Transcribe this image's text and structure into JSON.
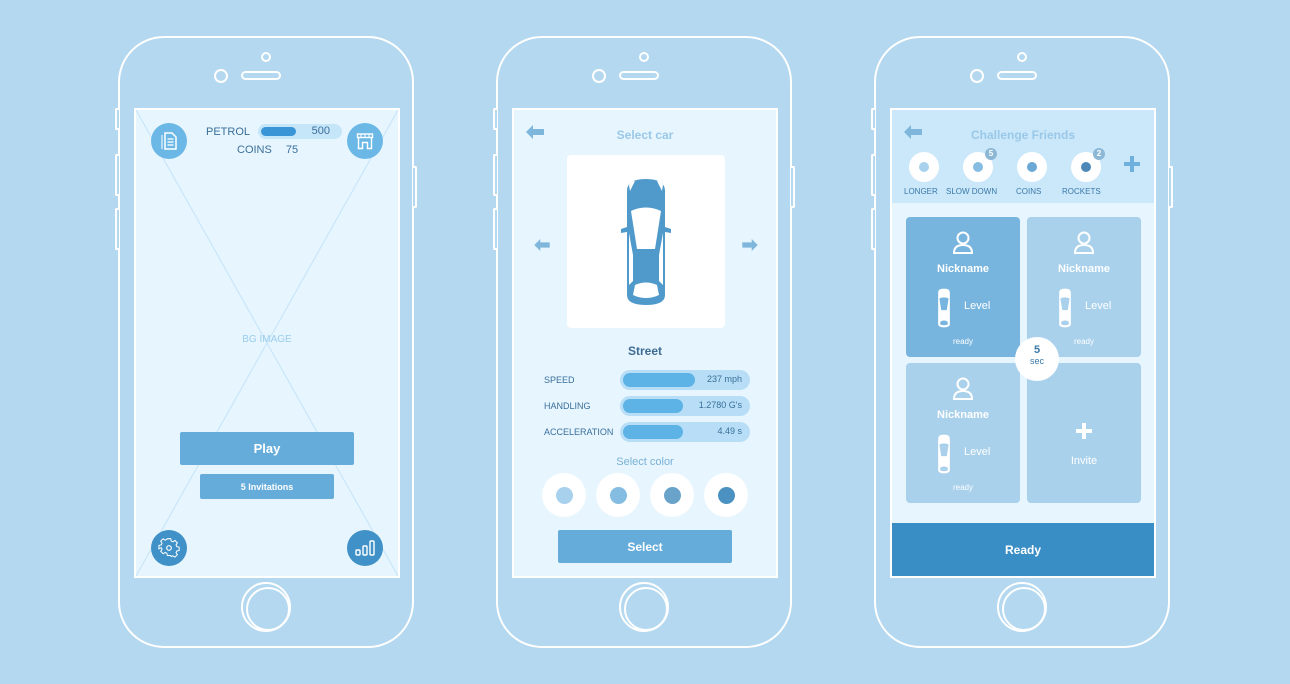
{
  "phone1": {
    "petrol_label": "PETROL",
    "petrol_value": "500",
    "petrol_level": 0.45,
    "coins_label": "COINS",
    "coins_value": "75",
    "bg_label": "BG IMAGE",
    "play_label": "Play",
    "invitations_label": "5 Invitations",
    "icons": {
      "top_left": "document-icon",
      "top_right": "shop-icon",
      "bottom_left": "gear-icon",
      "bottom_right": "stats-icon"
    }
  },
  "phone2": {
    "title": "Select car",
    "car_name": "Street",
    "stats": [
      {
        "label": "SPEED",
        "value": "237 mph",
        "level": 0.58
      },
      {
        "label": "HANDLING",
        "value": "1.2780 G's",
        "level": 0.48
      },
      {
        "label": "ACCELERATION",
        "value": "4.49 s",
        "level": 0.48
      }
    ],
    "select_color_label": "Select color",
    "colors": [
      "#a8d1ee",
      "#85bce2",
      "#6aa3c9",
      "#4b92c2"
    ],
    "select_label": "Select"
  },
  "phone3": {
    "title": "Challenge Friends",
    "powerups": [
      {
        "label": "LONGER",
        "color": "#a8d1ee",
        "badge": ""
      },
      {
        "label": "SLOW DOWN",
        "color": "#85bce2",
        "badge": "5"
      },
      {
        "label": "COINS",
        "color": "#6aa8d6",
        "badge": ""
      },
      {
        "label": "ROCKETS",
        "color": "#4b88b8",
        "badge": "2"
      }
    ],
    "players": [
      {
        "nickname": "Nickname",
        "level": "Level",
        "status": "ready",
        "active": true
      },
      {
        "nickname": "Nickname",
        "level": "Level",
        "status": "ready",
        "active": false
      },
      {
        "nickname": "Nickname",
        "level": "Level",
        "status": "ready",
        "active": false
      }
    ],
    "invite_label": "Invite",
    "timer_value": "5",
    "timer_unit": "sec",
    "ready_label": "Ready"
  }
}
